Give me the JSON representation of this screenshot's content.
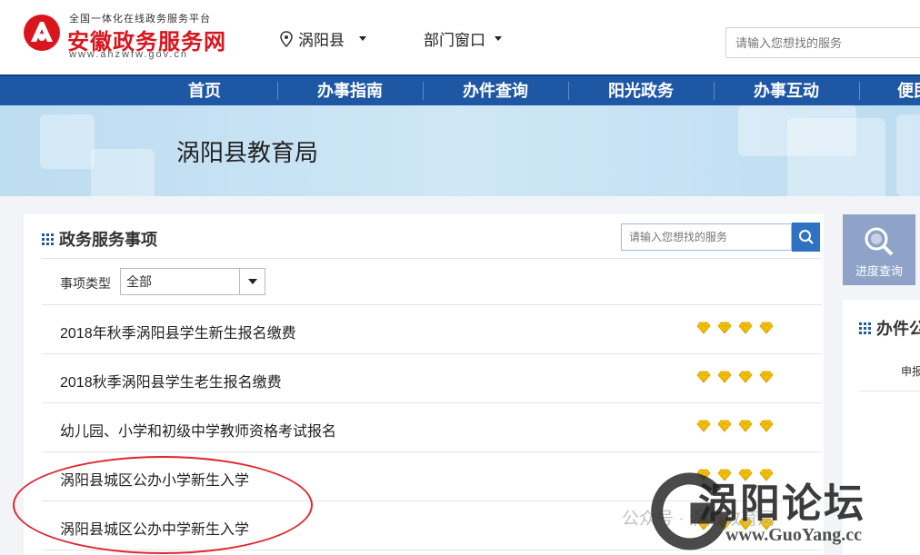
{
  "header": {
    "logo_sub": "全国一体化在线政务服务平台",
    "logo_main": "安徽政务服务网",
    "logo_url": "www.ahzwfw.gov.cn",
    "location": "涡阳县",
    "department": "部门窗口",
    "search_placeholder": "请输入您想找的服务"
  },
  "nav": {
    "items": [
      "首页",
      "办事指南",
      "办件查询",
      "阳光政务",
      "办事互动",
      "便民"
    ]
  },
  "banner": {
    "title": "涡阳县教育局"
  },
  "panel": {
    "title": "政务服务事项",
    "search_placeholder": "请输入您想找的服务",
    "filter_label": "事项类型",
    "filter_value": "全部",
    "items": [
      {
        "text": "2018年秋季涡阳县学生新生报名缴费",
        "rating": 4
      },
      {
        "text": "2018秋季涡阳县学生老生报名缴费",
        "rating": 4
      },
      {
        "text": "幼儿园、小学和初级中学教师资格考试报名",
        "rating": 4
      },
      {
        "text": "涡阳县城区公办小学新生入学",
        "rating": 4
      },
      {
        "text": "涡阳县城区公办中学新生入学",
        "rating": 4
      }
    ]
  },
  "side": {
    "progress_label": "进度查询",
    "panel_title": "办件公",
    "panel_sub": "申报"
  },
  "watermark": {
    "brand": "涡阳论坛",
    "url": "www.GuoYang.cc",
    "public": "公众号 · 涡阳教育局"
  },
  "colors": {
    "nav": "#1e57a4",
    "brand_red": "#d9161d",
    "annotation": "#e0262f",
    "gem": "#f5c400"
  }
}
